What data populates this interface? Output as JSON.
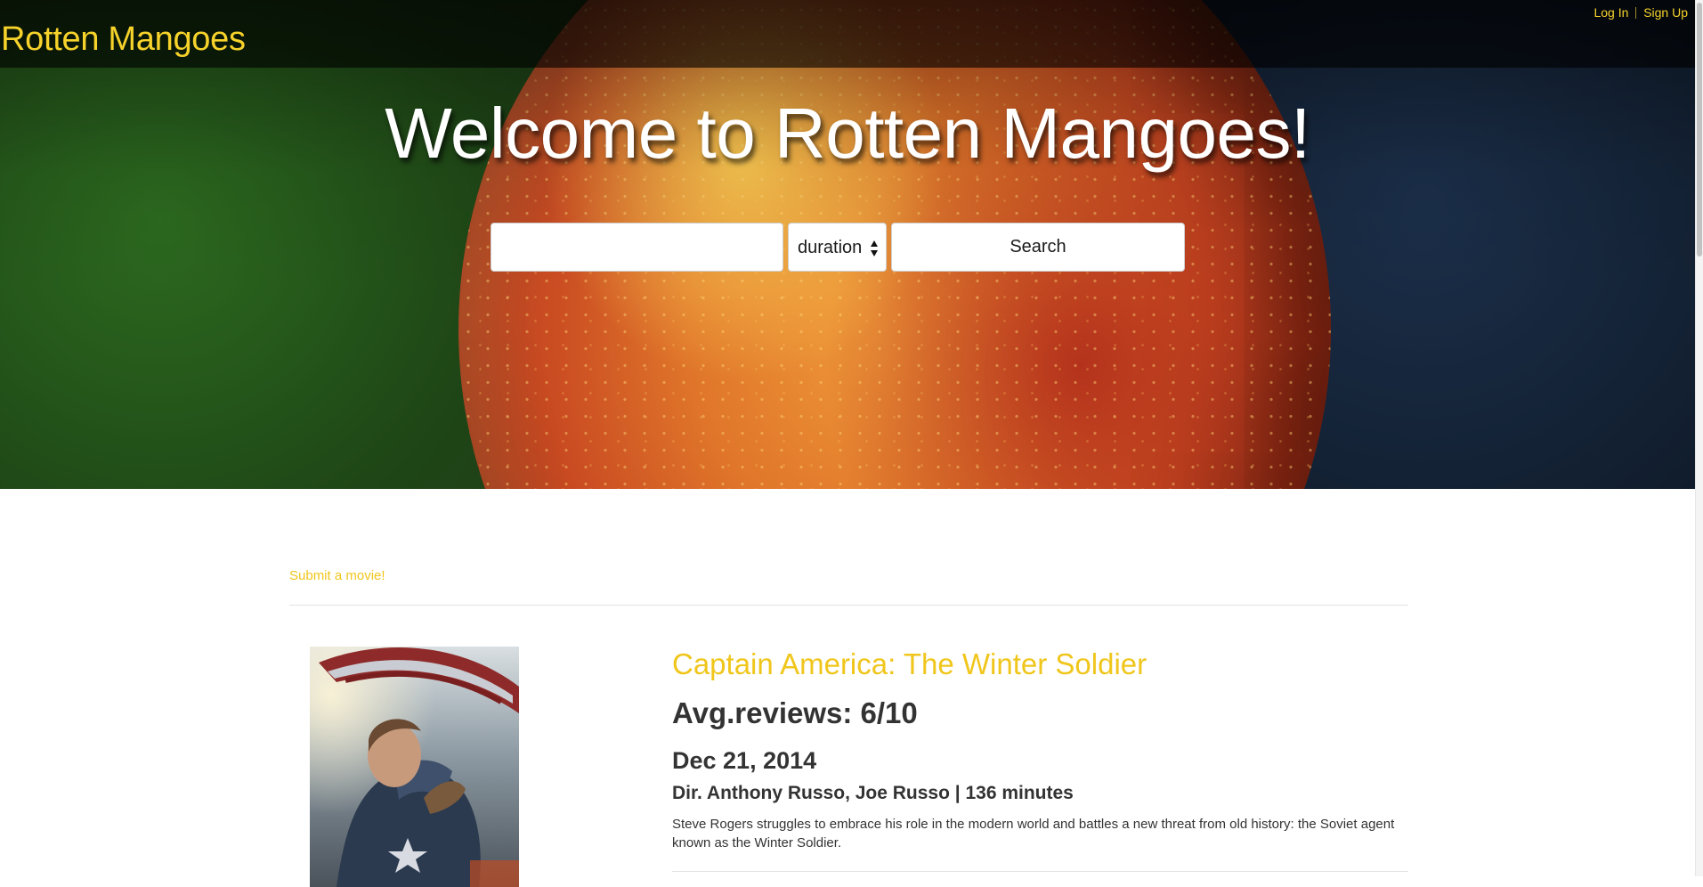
{
  "navbar": {
    "brand": "Rotten Mangoes",
    "login_label": "Log In",
    "signup_label": "Sign Up"
  },
  "hero": {
    "title": "Welcome to Rotten Mangoes!",
    "search": {
      "input_value": "",
      "placeholder": "",
      "sort_selected": "duration",
      "button_label": "Search"
    }
  },
  "main": {
    "submit_link": "Submit a movie!",
    "movies": [
      {
        "title": "Captain America: The Winter Soldier",
        "avg_reviews": "Avg.reviews: 6/10",
        "release_date": "Dec 21, 2014",
        "director_duration": "Dir. Anthony Russo, Joe Russo | 136 minutes",
        "description": "Steve Rogers struggles to embrace his role in the modern world and battles a new threat from old history: the Soviet agent known as the Winter Soldier."
      }
    ]
  },
  "icons": {
    "select_arrows": "updown-arrows-icon"
  },
  "colors": {
    "accent": "#f6d22b",
    "link": "#f0c61c",
    "text": "#333333",
    "navbar_bg": "rgba(0,0,0,0.62)"
  }
}
